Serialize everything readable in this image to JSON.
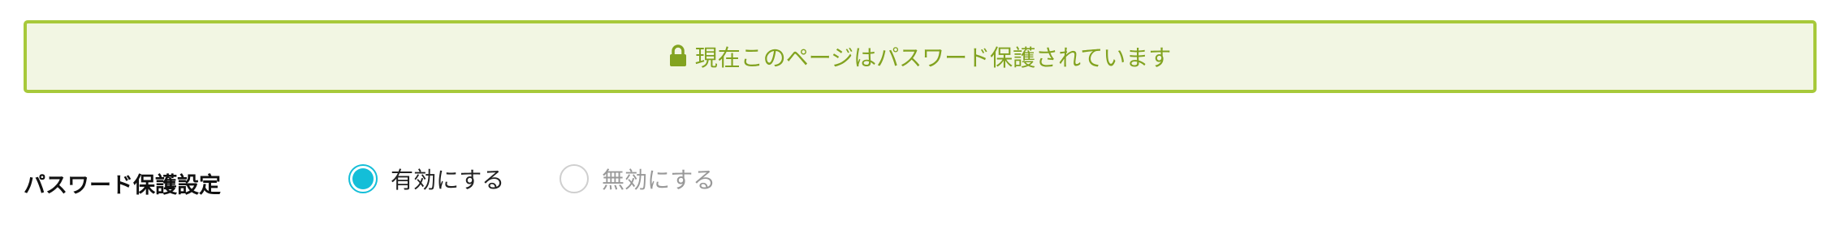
{
  "notice": {
    "icon": "lock-icon",
    "text": "現在このページはパスワード保護されています",
    "color": "#82a320",
    "border_color": "#a7c93a",
    "background": "#f2f6e3"
  },
  "password_setting": {
    "label": "パスワード保護設定",
    "options": [
      {
        "label": "有効にする",
        "checked": true
      },
      {
        "label": "無効にする",
        "checked": false
      }
    ],
    "accent_color": "#14bed8"
  }
}
